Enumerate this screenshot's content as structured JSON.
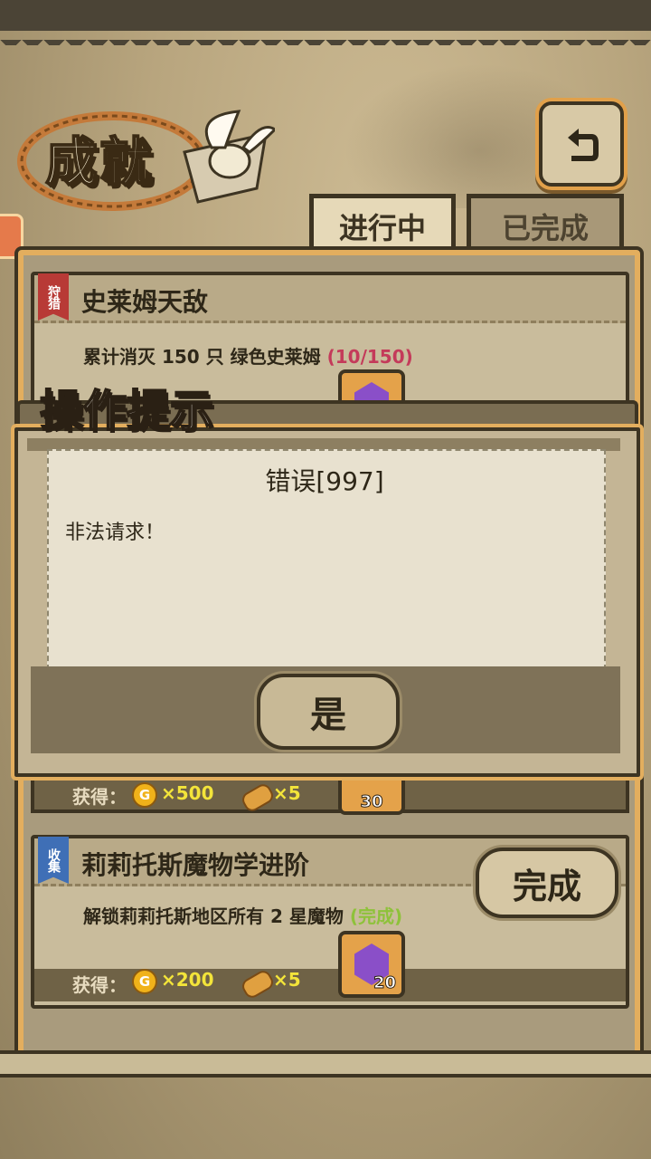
{
  "page": {
    "title": "成就",
    "back_icon": "back-arrow-icon"
  },
  "tabs": [
    {
      "label": "进行中",
      "active": true
    },
    {
      "label": "已完成",
      "active": false
    }
  ],
  "achievements": [
    {
      "category": "狩猎",
      "category_color": "#b83a36",
      "title": "史莱姆天敌",
      "description": "累计消灭 150 只 绿色史莱姆",
      "progress": "(10/150)",
      "reward_label": "获得：",
      "gold": "×500",
      "bread": "×5",
      "gem_count": "30"
    },
    {
      "category": "收集",
      "category_color": "#3f6fb6",
      "title": "莉莉托斯魔物学进阶",
      "description": "解锁莉莉托斯地区所有 2 星魔物",
      "progress": "(完成)",
      "reward_label": "获得：",
      "gold": "×200",
      "bread": "×5",
      "gem_count": "20",
      "button_label": "完成"
    }
  ],
  "coin_glyph": "G",
  "dialog": {
    "title": "操作提示",
    "heading": "错误[997]",
    "message": "非法请求！",
    "confirm_label": "是"
  }
}
